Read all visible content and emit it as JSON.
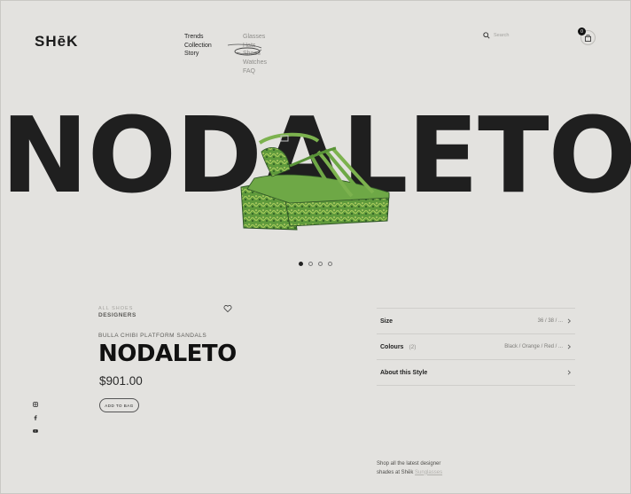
{
  "brand": {
    "logo": "SHēK"
  },
  "nav_primary": [
    "Trends",
    "Collection",
    "Story"
  ],
  "nav_secondary": [
    "Glasses",
    "Hats",
    "Shoes",
    "Watches",
    "FAQ"
  ],
  "search": {
    "placeholder": "Search"
  },
  "cart": {
    "count": "0"
  },
  "hero": {
    "title": "NODALETO",
    "slides": 4,
    "active_slide": 1
  },
  "product": {
    "designer_tag": "ALL SHOES",
    "designer_label": "DESIGNERS",
    "subtitle": "BULLA CHIBI PLATFORM SANDALS",
    "name": "NODALETO",
    "price": "$901.00",
    "add_label": "ADD TO BAG"
  },
  "specs": [
    {
      "label": "Size",
      "count": "",
      "value": "36 / 38 / ..."
    },
    {
      "label": "Colours",
      "count": "(2)",
      "value": "Black / Orange / Red / ..."
    },
    {
      "label": "About this Style",
      "count": "",
      "value": ""
    }
  ],
  "footer": {
    "line1": "Shop all the latest designer",
    "line2": "shades at Shēk",
    "link": "Sunglasses"
  },
  "colors": {
    "background": "#e3e2df",
    "text": "#1b1b1b",
    "shoe_green": "#5f9a3c"
  }
}
